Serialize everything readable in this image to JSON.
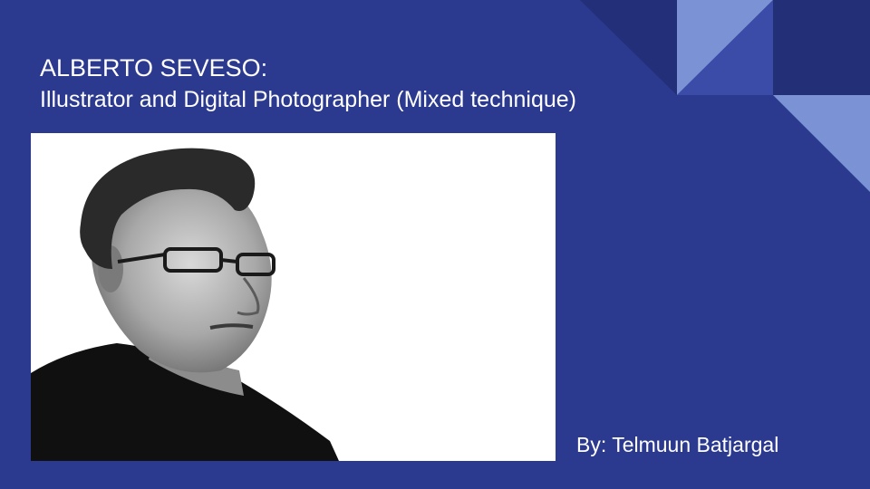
{
  "slide": {
    "title_line1": "ALBERTO SEVESO:",
    "title_line2": "Illustrator and Digital Photographer (Mixed technique)",
    "byline": "By: Telmuun Batjargal"
  },
  "image": {
    "subject": "black-and-white portrait photo of a man wearing glasses"
  },
  "colors": {
    "background": "#2b3a8f",
    "dark_navy": "#233077",
    "light_blue": "#7b93d4",
    "mid_blue": "#3a4ba8",
    "text": "#ffffff"
  }
}
